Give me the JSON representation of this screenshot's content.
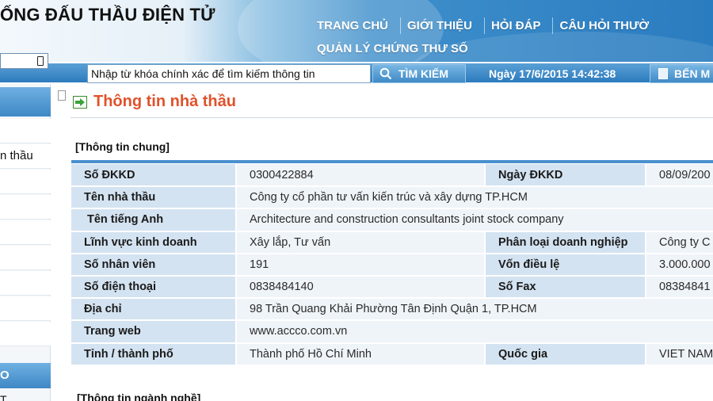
{
  "header": {
    "site_title": "ỐNG ĐẤU THẦU ĐIỆN TỬ",
    "nav": [
      "TRANG CHỦ",
      "GIỚI THIỆU",
      "HỎI ĐÁP",
      "CÂU HỎI THƯỜ"
    ],
    "nav_sub": "QUẢN LÝ CHỨNG THƯ SỐ"
  },
  "search": {
    "placeholder": "Nhập từ khóa chính xác để tìm kiếm thông tin",
    "button_label": "TÌM KIẾM",
    "date_text": "Ngày 17/6/2015 14:42:38",
    "right_button_label": "BẾN M"
  },
  "sidebar": {
    "items": [
      "n thầu"
    ],
    "section_label": "O",
    "last_label": "T"
  },
  "main": {
    "title": "Thông tin nhà thầu",
    "section1": "[Thông tin chung]",
    "section2": "[Thông tin ngành nghề]",
    "rows": [
      {
        "label": "Số ĐKKD",
        "value": "0300422884",
        "label2": "Ngày ĐKKD",
        "value2": "08/09/200"
      },
      {
        "label": "Tên nhà thầu",
        "value": "Công ty cổ phần tư vấn kiến trúc và xây dựng TP.HCM"
      },
      {
        "label": "Tên tiếng Anh",
        "value": "Architecture and construction consultants joint stock company"
      },
      {
        "label": "Lĩnh vực kinh doanh",
        "value": "Xây lắp, Tư vấn",
        "label2": "Phân loại doanh nghiệp",
        "value2": "Công ty C"
      },
      {
        "label": "Số nhân viên",
        "value": "191",
        "label2": "Vốn điều lệ",
        "value2": "3.000.000"
      },
      {
        "label": "Số điện thoại",
        "value": "0838484140",
        "label2": "Số Fax",
        "value2": "08384841"
      },
      {
        "label": "Địa chỉ",
        "value": "98 Trần Quang Khải Phường Tân Định Quận 1, TP.HCM"
      },
      {
        "label": "Trang web",
        "value": "www.accco.com.vn"
      },
      {
        "label": "Tỉnh / thành phố",
        "value": "Thành phố Hồ Chí Minh",
        "label2": "Quốc gia",
        "value2": "VIET NAM"
      }
    ]
  }
}
